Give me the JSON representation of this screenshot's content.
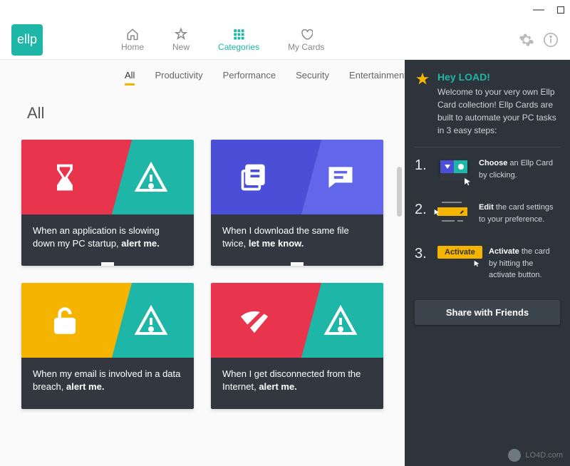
{
  "app": {
    "brand": "ellp"
  },
  "nav": {
    "home": "Home",
    "new": "New",
    "categories": "Categories",
    "mycards": "My Cards"
  },
  "subnav": {
    "all": "All",
    "productivity": "Productivity",
    "performance": "Performance",
    "security": "Security",
    "entertainment": "Entertainment"
  },
  "section_title": "All",
  "cards": [
    {
      "text_a": "When an application is slowing down my PC startup, ",
      "text_b": "alert me."
    },
    {
      "text_a": "When I download the same file twice, ",
      "text_b": "let me know."
    },
    {
      "text_a": "When my email is involved in a data breach, ",
      "text_b": "alert me."
    },
    {
      "text_a": "When I get disconnected from the Internet, ",
      "text_b": "alert me."
    }
  ],
  "sidebar": {
    "welcome_title": "Hey LOAD!",
    "welcome_text": "Welcome to your very own Ellp Card collection! Ellp Cards are built to automate your PC tasks in 3 easy steps:",
    "step1_num": "1.",
    "step1_b": "Choose",
    "step1_t": " an Ellp Card by clicking.",
    "step2_num": "2.",
    "step2_b": "Edit",
    "step2_t": " the card settings to your preference.",
    "step3_num": "3.",
    "step3_btn": "Activate",
    "step3_b": "Activate",
    "step3_t": " the card by hitting the activate button.",
    "share": "Share with Friends"
  },
  "watermark": "LO4D.com",
  "colors": {
    "teal": "#1eb6a6",
    "red": "#e8344d",
    "amber": "#f5b400",
    "indigo": "#4b4ed6",
    "indigo2": "#6266e8"
  }
}
